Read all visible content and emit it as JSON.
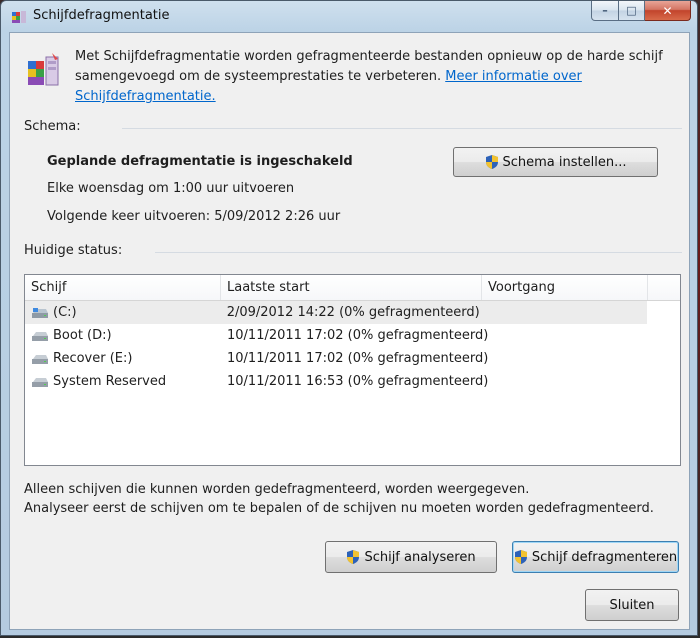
{
  "window": {
    "title": "Schijfdefragmentatie",
    "caption": {
      "minimize": "–",
      "maximize": "□",
      "close": "✕"
    }
  },
  "intro": {
    "text_line1": "Met Schijfdefragmentatie worden gefragmenteerde bestanden opnieuw op de harde schijf",
    "text_line2": "samengevoegd om de systeemprestaties te verbeteren. ",
    "link_part1": "Meer informatie over",
    "link_part2": "Schijfdefragmentatie."
  },
  "schedule": {
    "label": "Schema:",
    "status": "Geplande defragmentatie is ingeschakeld",
    "frequency": "Elke woensdag om 1:00 uur uitvoeren",
    "next_run": "Volgende keer uitvoeren: 5/09/2012 2:26 uur",
    "button_label": "Schema instellen..."
  },
  "current_status": {
    "label": "Huidige status:",
    "columns": [
      "Schijf",
      "Laatste start",
      "Voortgang"
    ],
    "rows": [
      {
        "drive": "(C:)",
        "last_run": "2/09/2012 14:22 (0% gefragmenteerd)",
        "progress": "",
        "icon": "system-drive-icon",
        "selected": true
      },
      {
        "drive": "Boot (D:)",
        "last_run": "10/11/2011 17:02 (0% gefragmenteerd)",
        "progress": "",
        "icon": "drive-icon",
        "selected": false
      },
      {
        "drive": "Recover (E:)",
        "last_run": "10/11/2011 17:02 (0% gefragmenteerd)",
        "progress": "",
        "icon": "drive-icon",
        "selected": false
      },
      {
        "drive": "System Reserved",
        "last_run": "10/11/2011 16:53 (0% gefragmenteerd)",
        "progress": "",
        "icon": "drive-icon",
        "selected": false
      }
    ]
  },
  "footer": {
    "line1": "Alleen schijven die kunnen worden gedefragmenteerd, worden weergegeven.",
    "line2": "Analyseer eerst de schijven om te bepalen of de schijven nu moeten worden gedefragmenteerd.",
    "analyze_button": "Schijf analyseren",
    "defrag_button": "Schijf defragmenteren",
    "close_button": "Sluiten"
  },
  "colors": {
    "link": "#0066cc",
    "accent": "#3c7fb1",
    "close_button": "#c2442c"
  }
}
